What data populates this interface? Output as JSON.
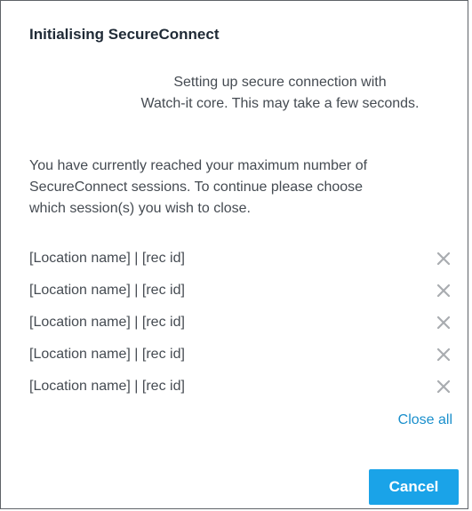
{
  "dialog": {
    "title": "Initialising SecureConnect",
    "setup_message": [
      "Setting up secure connection with",
      "Watch-it core. This may take a few seconds."
    ],
    "limit_message": [
      "You have currently reached your maximum number of",
      "SecureConnect sessions. To continue please choose",
      "which session(s) you wish to close."
    ],
    "sessions": [
      {
        "label": "[Location name] | [rec id]",
        "close_icon": "close-icon"
      },
      {
        "label": "[Location name] | [rec id]",
        "close_icon": "close-icon"
      },
      {
        "label": "[Location name] | [rec id]",
        "close_icon": "close-icon"
      },
      {
        "label": "[Location name] | [rec id]",
        "close_icon": "close-icon"
      },
      {
        "label": "[Location name] | [rec id]",
        "close_icon": "close-icon"
      }
    ],
    "close_all_label": "Close all",
    "cancel_label": "Cancel"
  },
  "colors": {
    "accent": "#1aa3e8",
    "link": "#1a8fcc",
    "text": "#454b52",
    "title": "#1f2a36",
    "icon": "#a9acb0"
  }
}
